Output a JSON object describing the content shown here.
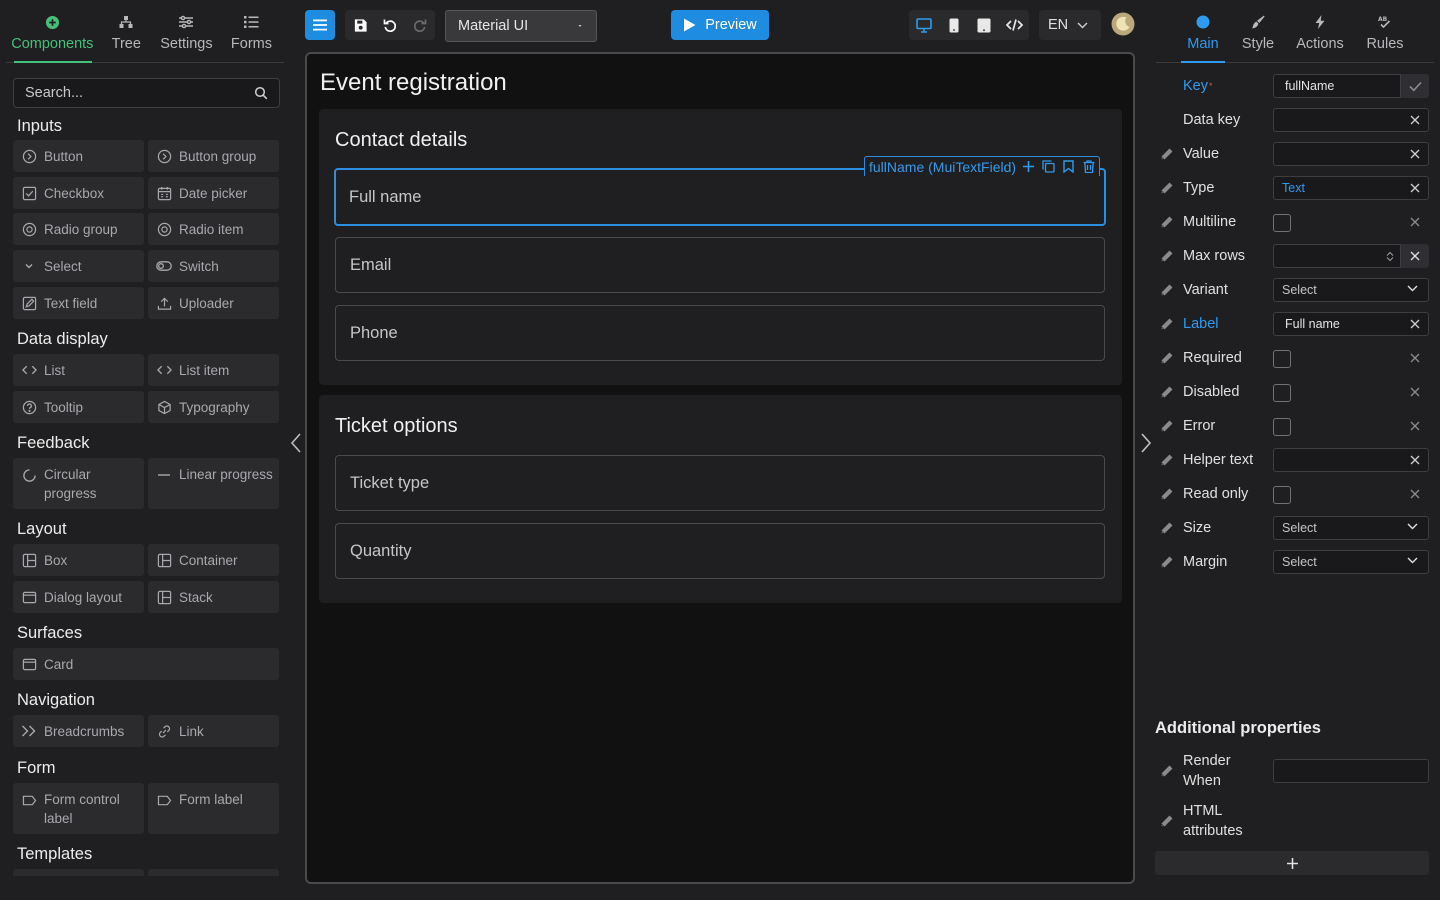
{
  "left_panel": {
    "tabs": [
      {
        "label": "Components",
        "icon": "plus-circle-icon"
      },
      {
        "label": "Tree",
        "icon": "tree-icon"
      },
      {
        "label": "Settings",
        "icon": "sliders-icon"
      },
      {
        "label": "Forms",
        "icon": "list-icon"
      }
    ],
    "search": {
      "placeholder": "Search..."
    },
    "sections": [
      {
        "title": "Inputs",
        "items": [
          "Button",
          "Button group",
          "Checkbox",
          "Date picker",
          "Radio group",
          "Radio item",
          "Select",
          "Switch",
          "Text field",
          "Uploader"
        ]
      },
      {
        "title": "Data display",
        "items": [
          "List",
          "List item",
          "Tooltip",
          "Typography"
        ]
      },
      {
        "title": "Feedback",
        "items": [
          "Circular progress",
          "Linear progress"
        ]
      },
      {
        "title": "Layout",
        "items": [
          "Box",
          "Container",
          "Dialog layout",
          "Stack"
        ]
      },
      {
        "title": "Surfaces",
        "items": [
          "Card"
        ]
      },
      {
        "title": "Navigation",
        "items": [
          "Breadcrumbs",
          "Link"
        ]
      },
      {
        "title": "Form",
        "items": [
          "Form control label",
          "Form label"
        ]
      },
      {
        "title": "Templates",
        "items": []
      }
    ]
  },
  "toolbar": {
    "library": "Material UI",
    "preview_label": "Preview",
    "language": "EN"
  },
  "canvas": {
    "form_title": "Event registration",
    "cards": [
      {
        "title": "Contact details",
        "fields": [
          "Full name",
          "Email",
          "Phone"
        ]
      },
      {
        "title": "Ticket options",
        "fields": [
          "Ticket type",
          "Quantity"
        ]
      }
    ],
    "selected_tag": "fullName (MuiTextField)"
  },
  "right_panel": {
    "tabs": [
      {
        "label": "Main",
        "icon": "dot-icon"
      },
      {
        "label": "Style",
        "icon": "brush-icon"
      },
      {
        "label": "Actions",
        "icon": "bolt-icon"
      },
      {
        "label": "Rules",
        "icon": "rules-icon"
      }
    ],
    "props": {
      "key": {
        "label": "Key",
        "value": "fullName"
      },
      "data_key": {
        "label": "Data key",
        "value": ""
      },
      "value": {
        "label": "Value",
        "value": ""
      },
      "type": {
        "label": "Type",
        "value": "Text"
      },
      "multiline": {
        "label": "Multiline"
      },
      "max_rows": {
        "label": "Max rows",
        "value": ""
      },
      "variant": {
        "label": "Variant",
        "value": "Select"
      },
      "label": {
        "label": "Label",
        "value": "Full name"
      },
      "required": {
        "label": "Required"
      },
      "disabled": {
        "label": "Disabled"
      },
      "error": {
        "label": "Error"
      },
      "helper_text": {
        "label": "Helper text",
        "value": ""
      },
      "read_only": {
        "label": "Read only"
      },
      "size": {
        "label": "Size",
        "value": "Select"
      },
      "margin": {
        "label": "Margin",
        "value": "Select"
      }
    },
    "additional": {
      "title": "Additional properties",
      "render_when": "Render When",
      "html_attributes": "HTML attributes"
    }
  },
  "colors": {
    "accent_green": "#45c07a",
    "accent_blue": "#2f9bf0",
    "button_blue": "#1e8ce0",
    "background": "#1f1f21",
    "canvas": "#111112"
  }
}
